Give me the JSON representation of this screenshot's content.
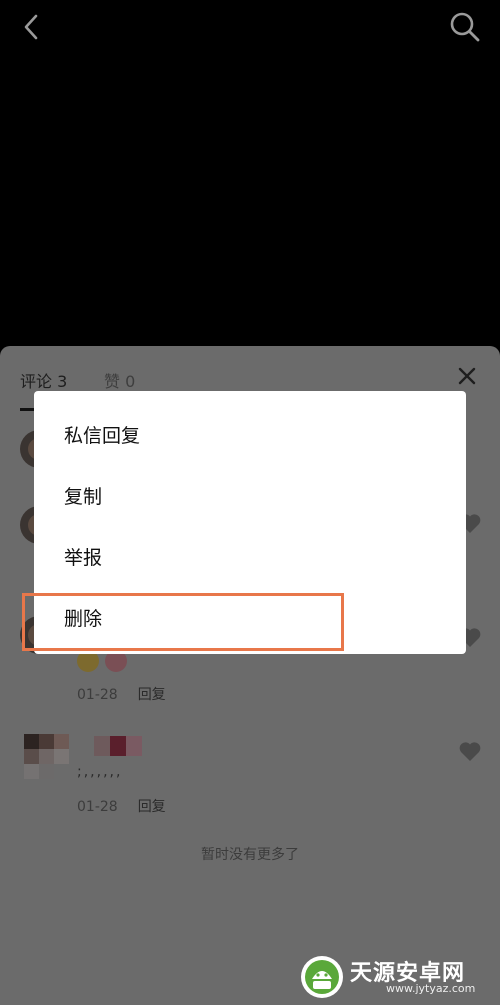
{
  "tabs": {
    "comments": "评论 3",
    "likes": "赞 0"
  },
  "menu": {
    "items": [
      "私信回复",
      "复制",
      "举报",
      "删除"
    ],
    "highlighted_item": "删除"
  },
  "comments": [
    {
      "date": "01-28",
      "reply_label": "回复"
    },
    {
      "date": "01-28",
      "reply_label": "回复",
      "text": ";,,,,,,"
    }
  ],
  "footer": {
    "no_more": "暂时没有更多了"
  },
  "watermark": {
    "title": "天源安卓网",
    "url": "www.jytyaz.com"
  },
  "colors": {
    "highlight_border": "#e8774a",
    "sheet_dimmed": "#6b6b6b",
    "menu_bg": "#ffffff"
  }
}
